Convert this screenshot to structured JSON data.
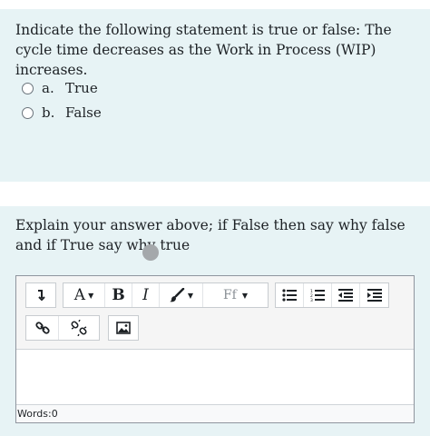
{
  "question1": {
    "text": "Indicate the following statement is true or false: The cycle time decreases as the Work in Process (WIP) increases.",
    "options": [
      {
        "letter": "a.",
        "label": "True"
      },
      {
        "letter": "b.",
        "label": "False"
      }
    ]
  },
  "question2": {
    "text": "Explain your answer above; if False then say why false and if True say why true"
  },
  "editor": {
    "font_size_label": "A",
    "bold_label": "B",
    "italic_label": "I",
    "font_family_label": "Ff",
    "word_count_label": "Words:",
    "word_count_value": "0"
  }
}
